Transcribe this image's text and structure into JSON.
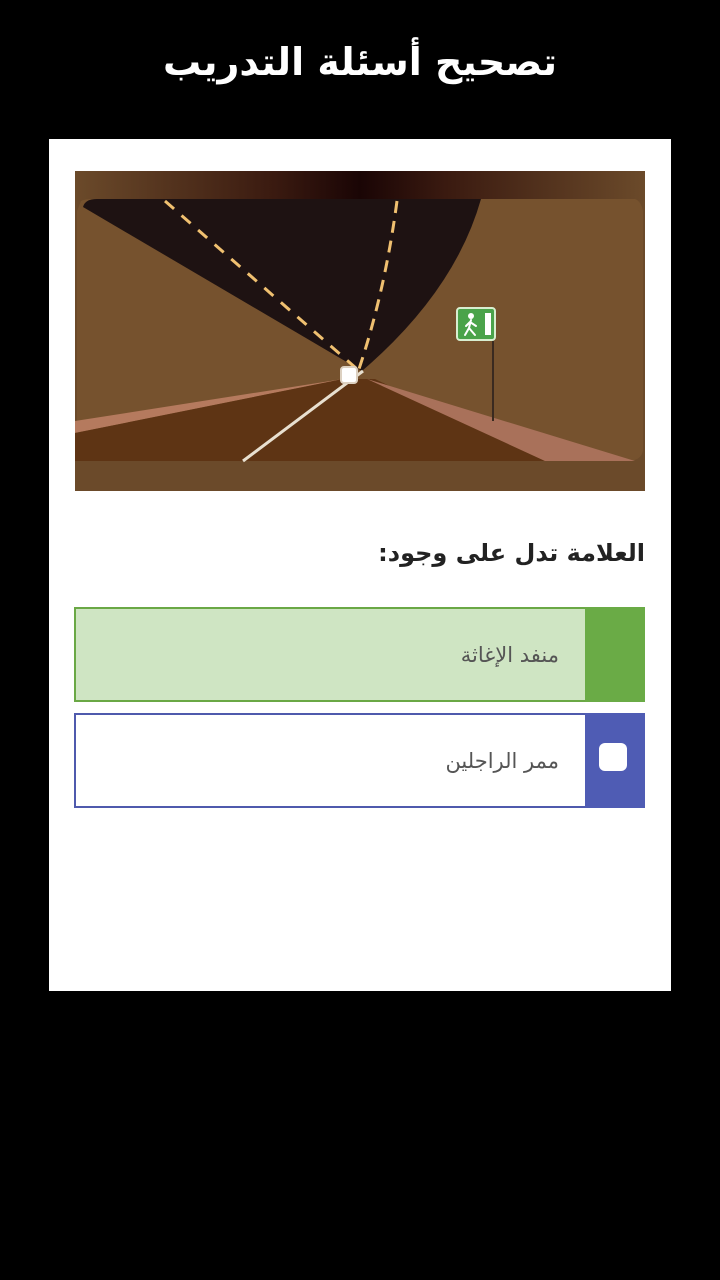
{
  "header": {
    "title": "تصحيح أسئلة التدريب"
  },
  "question": {
    "text": "العلامة تدل على وجود:"
  },
  "answers": [
    {
      "label": "منفد الإغاثة",
      "state": "correct",
      "color": "#6aab46"
    },
    {
      "label": "ممر الراجلين",
      "state": "unselected",
      "color": "#4f5cb4"
    }
  ],
  "image": {
    "sign_icon": "pedestrian-exit-icon"
  }
}
